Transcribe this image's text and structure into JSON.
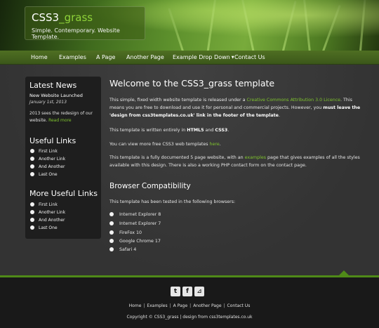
{
  "header": {
    "title_main": "CSS3",
    "title_accent": "_grass",
    "slogan": "Simple. Contemporary. Website Template."
  },
  "nav": {
    "items": [
      {
        "label": "Home"
      },
      {
        "label": "Examples"
      },
      {
        "label": "A Page"
      },
      {
        "label": "Another Page"
      },
      {
        "label": "Example Drop Down"
      },
      {
        "label": "Contact Us"
      }
    ],
    "dropdown_caret": "▼"
  },
  "sidebar": {
    "news_heading": "Latest News",
    "news_item_title": "New Website Launched",
    "news_item_date": "January 1st, 2013",
    "news_item_text_1": "2013 sees the redesign of our",
    "news_item_text_2": "website.",
    "news_item_link": "Read more",
    "useful_heading": "Useful Links",
    "useful_links": [
      "First Link",
      "Another Link",
      "And Another",
      "Last One"
    ],
    "more_heading": "More Useful Links",
    "more_links": [
      "First Link",
      "Another Link",
      "And Another",
      "Last One"
    ]
  },
  "content": {
    "heading": "Welcome to the CSS3_grass template",
    "p1_a": "This simple, fixed width website template is released under a",
    "p1_link": "Creative Commons Attribution 3.0 Licence",
    "p1_b": ". This",
    "p1_c": "means you are free to download and use it for personal and commercial projects. However, you",
    "p1_bold1": "must leave",
    "p1_bold2": "the 'design from css3templates.co.uk' link in the footer of the template",
    "p1_end": ".",
    "p2_a": "This template is written entirely in",
    "p2_b1": "HTML5",
    "p2_and": "and",
    "p2_b2": "CSS3",
    "p2_end": ".",
    "p3_a": "You can view more free CSS3 web templates",
    "p3_link": "here",
    "p3_end": ".",
    "p4_a": "This template is a fully documented 5 page website, with an",
    "p4_link": "examples",
    "p4_b": "page that gives examples of all the",
    "p4_c": "styles available with this design. There is also a working PHP contact form on the contact page.",
    "subheading": "Browser Compatibility",
    "browsers_intro": "This template has been tested in the following browsers:",
    "browsers": [
      "Internet Explorer 8",
      "Internet Explorer 7",
      "FireFox 10",
      "Google Chrome 17",
      "Safari 4"
    ]
  },
  "footer": {
    "social_icons": [
      {
        "icon": "twitter-icon",
        "glyph": "t"
      },
      {
        "icon": "facebook-icon",
        "glyph": "f"
      },
      {
        "icon": "rss-icon",
        "glyph": "⊿"
      }
    ],
    "links": [
      "Home",
      "Examples",
      "A Page",
      "Another Page",
      "Contact Us"
    ],
    "separator": "|",
    "copyright": "Copyright © CSS3_grass | design from css3templates.co.uk"
  },
  "colors": {
    "accent_green": "#7fc42e",
    "footer_line": "#4f8a18",
    "nav_bar": "#4f6f22",
    "background": "#333333",
    "footer_bg": "#191919"
  }
}
